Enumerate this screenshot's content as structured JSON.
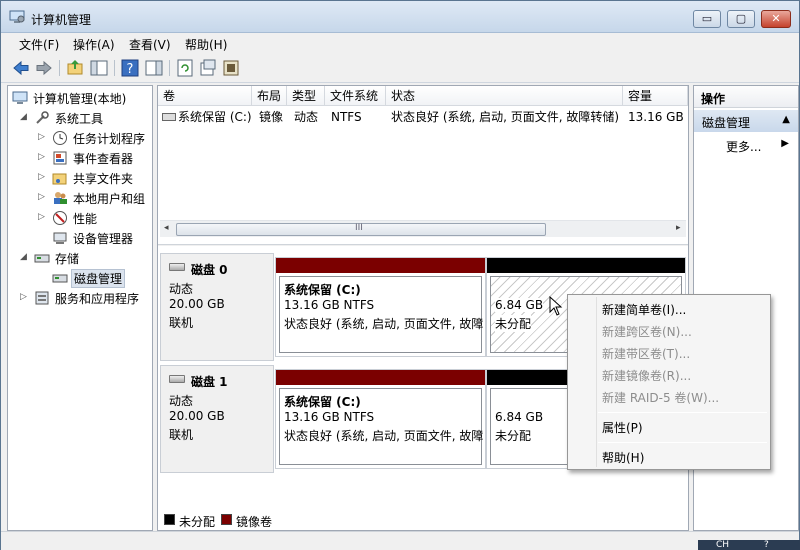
{
  "window": {
    "title": "计算机管理",
    "controls": {
      "minimize": "▭",
      "maximize": "▢",
      "close": "✕"
    }
  },
  "menubar": {
    "items": [
      "文件(F)",
      "操作(A)",
      "查看(V)",
      "帮助(H)"
    ]
  },
  "toolbar": {
    "icons": [
      "back-icon",
      "forward-icon",
      "up-folder-icon",
      "show-hide-tree-icon",
      "help-icon",
      "properties-pane-icon",
      "refresh-icon",
      "export-list-icon",
      "settings-icon"
    ]
  },
  "tree": {
    "items": [
      {
        "label": "计算机管理(本地)",
        "icon": "computer-management-icon",
        "expander": ""
      },
      {
        "label": "系统工具",
        "icon": "system-tools-icon",
        "expander": "◢"
      },
      {
        "label": "任务计划程序",
        "icon": "task-scheduler-icon",
        "expander": "▷"
      },
      {
        "label": "事件查看器",
        "icon": "event-viewer-icon",
        "expander": "▷"
      },
      {
        "label": "共享文件夹",
        "icon": "shared-folders-icon",
        "expander": "▷"
      },
      {
        "label": "本地用户和组",
        "icon": "local-users-icon",
        "expander": "▷"
      },
      {
        "label": "性能",
        "icon": "performance-icon",
        "expander": "▷"
      },
      {
        "label": "设备管理器",
        "icon": "device-manager-icon",
        "expander": ""
      },
      {
        "label": "存储",
        "icon": "storage-icon",
        "expander": "◢"
      },
      {
        "label": "磁盘管理",
        "icon": "disk-management-icon",
        "expander": ""
      },
      {
        "label": "服务和应用程序",
        "icon": "services-apps-icon",
        "expander": "▷"
      }
    ],
    "selected": "磁盘管理"
  },
  "volume_list": {
    "columns": [
      "卷",
      "布局",
      "类型",
      "文件系统",
      "状态",
      "容量"
    ],
    "rows": [
      [
        "系统保留 (C:)",
        "镜像",
        "动态",
        "NTFS",
        "状态良好 (系统, 启动, 页面文件, 故障转储)",
        "13.16 GB"
      ]
    ],
    "scroll_grip": "III",
    "scroll_left": "◂",
    "scroll_right": "▸"
  },
  "disks": [
    {
      "name": "磁盘 0",
      "type": "动态",
      "size": "20.00 GB",
      "status": "联机",
      "volumes": [
        {
          "title": "系统保留   (C:)",
          "size_fs": "13.16 GB NTFS",
          "status": "状态良好 (系统, 启动, 页面文件, 故障",
          "kind": "mirror"
        },
        {
          "title": "",
          "size_fs": "6.84 GB",
          "status": "未分配",
          "kind": "unallocated"
        }
      ]
    },
    {
      "name": "磁盘 1",
      "type": "动态",
      "size": "20.00 GB",
      "status": "联机",
      "volumes": [
        {
          "title": "系统保留   (C:)",
          "size_fs": "13.16 GB NTFS",
          "status": "状态良好 (系统, 启动, 页面文件, 故障",
          "kind": "mirror"
        },
        {
          "title": "",
          "size_fs": "6.84 GB",
          "status": "未分配",
          "kind": "unallocated"
        }
      ]
    }
  ],
  "legend": {
    "items": [
      {
        "label": "未分配",
        "color": "#000000"
      },
      {
        "label": "镜像卷",
        "color": "#7b0000"
      }
    ]
  },
  "actions": {
    "header": "操作",
    "section": "磁盘管理",
    "section_toggle": "▲",
    "more": "更多...",
    "more_arrow": "▶"
  },
  "context_menu": {
    "items": [
      {
        "label": "新建简单卷(I)...",
        "enabled": true
      },
      {
        "label": "新建跨区卷(N)...",
        "enabled": false
      },
      {
        "label": "新建带区卷(T)...",
        "enabled": false
      },
      {
        "label": "新建镜像卷(R)...",
        "enabled": false
      },
      {
        "label": "新建 RAID-5 卷(W)...",
        "enabled": false
      },
      {
        "label": "属性(P)",
        "enabled": true
      },
      {
        "label": "帮助(H)",
        "enabled": true
      }
    ]
  },
  "tray": {
    "ime": "CH",
    "help": "?"
  },
  "colors": {
    "mirror": "#7b0000",
    "unallocated": "#000000",
    "accent": "#c9d8eb"
  }
}
